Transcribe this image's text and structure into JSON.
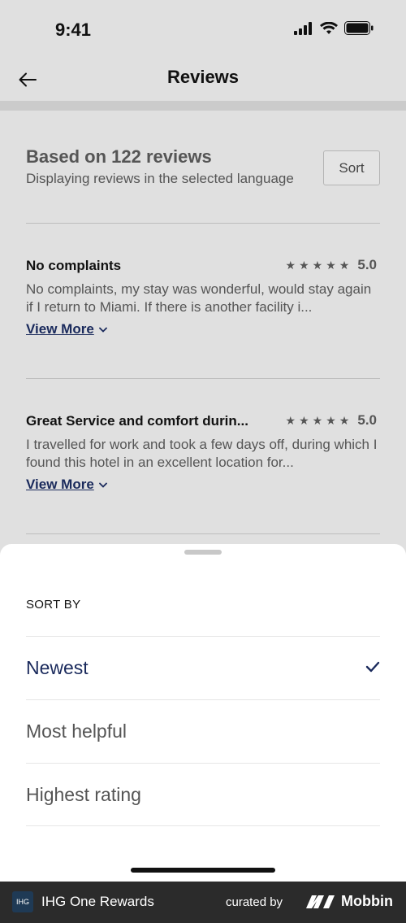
{
  "status": {
    "time": "9:41"
  },
  "nav": {
    "title": "Reviews"
  },
  "summary": {
    "title": "Based on 122 reviews",
    "subtitle": "Displaying reviews in the selected language",
    "sort_label": "Sort"
  },
  "reviews": [
    {
      "title": "No complaints",
      "rating": "5.0",
      "stars": 5,
      "text": "No complaints, my stay was wonderful, would stay again if I return to Miami. If there is another facility i...",
      "view_more": "View More"
    },
    {
      "title": "Great Service and comfort durin...",
      "rating": "5.0",
      "stars": 5,
      "text": "I travelled for work and took a few days off, during which I found this hotel in an excellent location for...",
      "view_more": "View More"
    }
  ],
  "sheet": {
    "heading": "SORT BY",
    "options": [
      {
        "label": "Newest",
        "selected": true
      },
      {
        "label": "Most helpful",
        "selected": false
      },
      {
        "label": "Highest rating",
        "selected": false
      }
    ]
  },
  "footer": {
    "brand_logo_text": "IHG",
    "brand_name": "IHG One Rewards",
    "curated_by": "curated by",
    "mobbin": "Mobbin"
  },
  "colors": {
    "accent": "#1a2a5c",
    "footer_bg": "#2b2b2b"
  }
}
